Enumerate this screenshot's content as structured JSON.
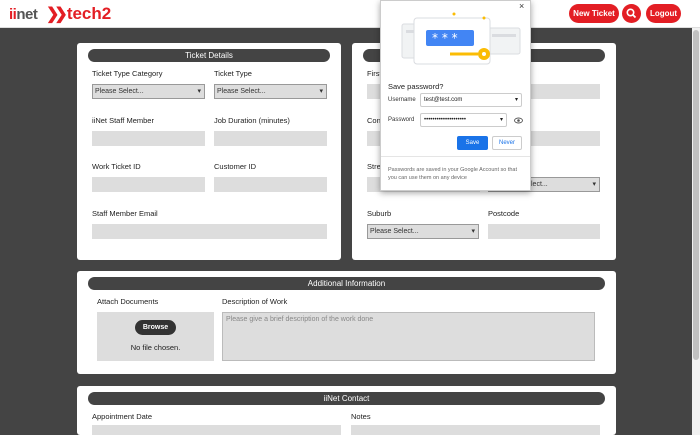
{
  "header": {
    "logo_a": "ii",
    "logo_b": "net",
    "logo_tech": "tech2",
    "new_ticket": "New Ticket",
    "logout": "Logout"
  },
  "ticket_details": {
    "title": "Ticket Details",
    "type_category_label": "Ticket Type Category",
    "type_category_value": "Please Select...",
    "type_label": "Ticket Type",
    "type_value": "Please Select...",
    "staff_member_label": "iiNet Staff Member",
    "job_duration_label": "Job Duration (minutes)",
    "work_ticket_label": "Work Ticket ID",
    "customer_id_label": "Customer ID",
    "staff_email_label": "Staff Member Email"
  },
  "customer": {
    "first_label": "First",
    "con_label": "Con",
    "stre_label": "Stre",
    "state_value": "lect...",
    "suburb_label": "Suburb",
    "suburb_value": "Please Select...",
    "postcode_label": "Postcode"
  },
  "additional": {
    "title": "Additional Information",
    "attach_label": "Attach Documents",
    "browse_label": "Browse",
    "no_file": "No file chosen.",
    "description_label": "Description of Work",
    "description_placeholder": "Please give a brief description of the work done"
  },
  "contact": {
    "title": "iiNet Contact",
    "appointment_label": "Appointment Date",
    "notes_label": "Notes"
  },
  "password_popup": {
    "close": "×",
    "title": "Save password?",
    "username_label": "Username",
    "username_value": "test@test.com",
    "password_label": "Password",
    "password_value": "••••••••••••••••••••",
    "save": "Save",
    "never": "Never",
    "note": "Passwords are saved in your Google Account so that you can use them on any device"
  },
  "colors": {
    "brand_red": "#e31e24",
    "dark": "#444444",
    "google_blue": "#1a73e8"
  }
}
